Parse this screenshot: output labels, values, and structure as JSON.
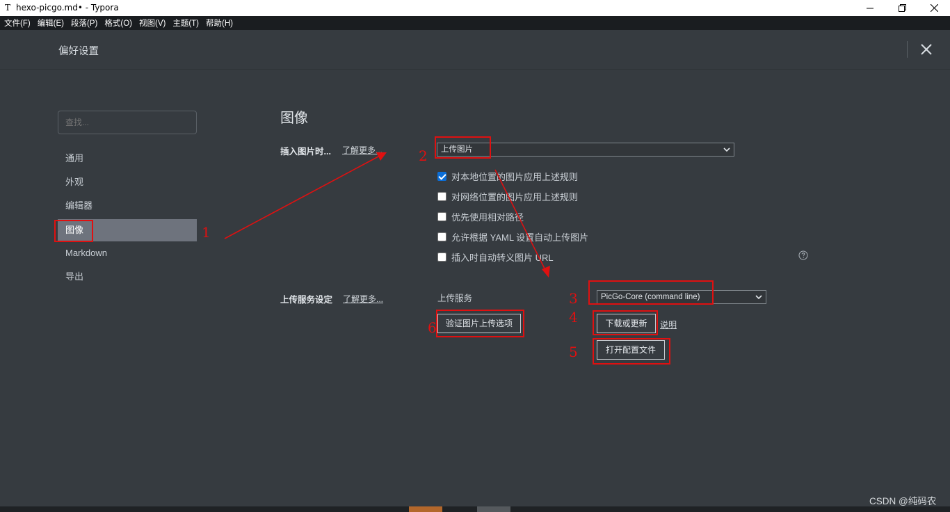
{
  "window": {
    "app_icon": "T",
    "title": "hexo-picgo.md• - Typora",
    "controls": [
      "minimize-icon",
      "restore-icon",
      "close-icon"
    ]
  },
  "menubar": {
    "items": [
      "文件(F)",
      "编辑(E)",
      "段落(P)",
      "格式(O)",
      "视图(V)",
      "主题(T)",
      "帮助(H)"
    ]
  },
  "preferences": {
    "title": "偏好设置",
    "search_placeholder": "查找...",
    "nav": [
      "通用",
      "外观",
      "编辑器",
      "图像",
      "Markdown",
      "导出"
    ],
    "active_nav": "图像",
    "section_title": "图像",
    "insert_image": {
      "label": "插入图片时...",
      "learn_more": "了解更多...",
      "selected_action": "上传图片",
      "options": [
        {
          "label": "对本地位置的图片应用上述规则",
          "checked": true
        },
        {
          "label": "对网络位置的图片应用上述规则",
          "checked": false
        },
        {
          "label": "优先使用相对路径",
          "checked": false
        },
        {
          "label": "允许根据 YAML 设置自动上传图片",
          "checked": false
        },
        {
          "label": "插入时自动转义图片 URL",
          "checked": false
        }
      ]
    },
    "upload": {
      "label": "上传服务设定",
      "learn_more": "了解更多...",
      "service_label": "上传服务",
      "service_selected": "PicGo-Core (command line)",
      "download_button": "下载或更新",
      "explain_link": "说明",
      "open_config_button": "打开配置文件",
      "verify_button": "验证图片上传选项"
    }
  },
  "annotations": {
    "color": "#e01010",
    "numbers": [
      "1",
      "2",
      "3",
      "4",
      "5",
      "6"
    ]
  },
  "watermark": "CSDN @纯码农"
}
